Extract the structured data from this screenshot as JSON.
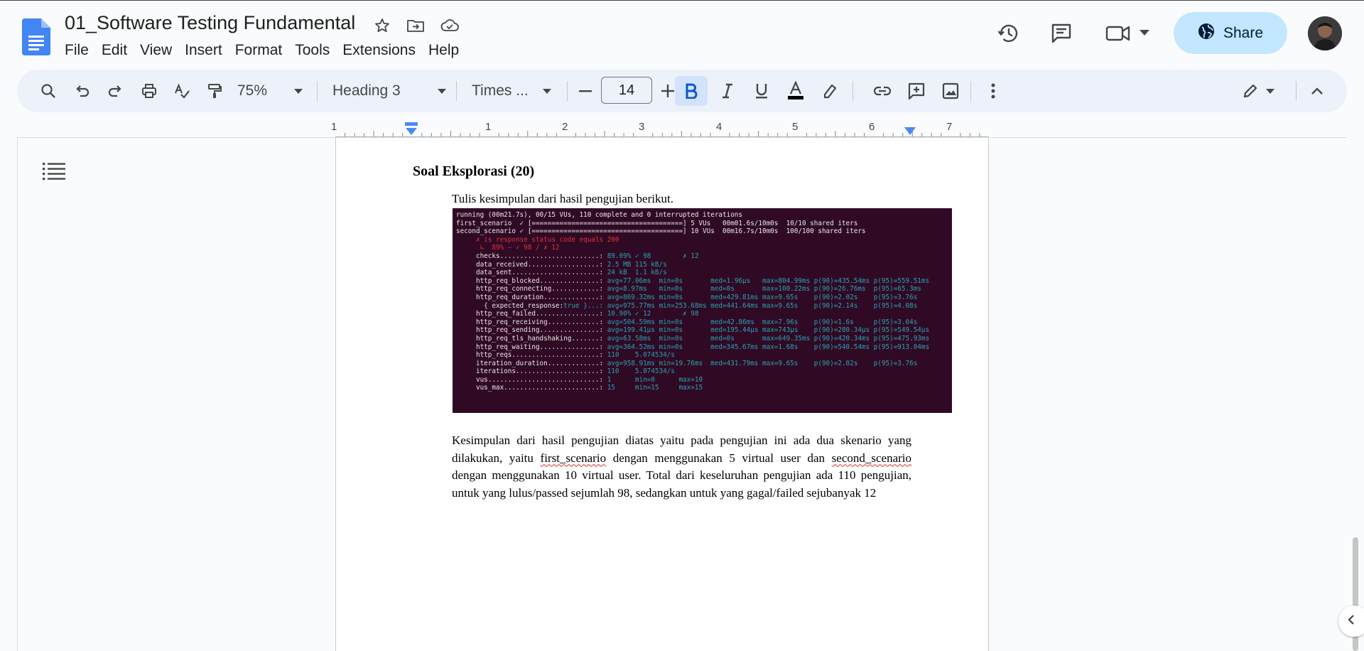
{
  "document": {
    "title": "01_Software Testing Fundamental"
  },
  "menu": [
    "File",
    "Edit",
    "View",
    "Insert",
    "Format",
    "Tools",
    "Extensions",
    "Help"
  ],
  "header": {
    "share_label": "Share"
  },
  "toolbar": {
    "zoom": "75%",
    "style": "Heading 3",
    "font": "Times ...",
    "font_size": "14"
  },
  "ruler": {
    "numbers": [
      "1",
      "1",
      "2",
      "3",
      "4",
      "5",
      "6",
      "7"
    ]
  },
  "page": {
    "heading": "Soal Eksplorasi (20)",
    "instruction": "Tulis kesimpulan dari hasil pengujian berikut.",
    "terminal_lines": [
      "running (00m21.7s), 00/15 VUs, 110 complete and 0 interrupted iterations",
      "first_scenario  ✓ [======================================] 5 VUs   00m01.6s/10m0s  10/10 shared iters",
      "second_scenario ✓ [======================================] 10 VUs  00m16.7s/10m0s  100/100 shared iters",
      "",
      "     ✗ is response status code equals 200",
      "      ↳  89% — ✓ 98 / ✗ 12",
      "",
      "     checks.........................: 89.09% ✓ 98        ✗ 12",
      "     data_received..................: 2.5 MB 115 kB/s",
      "     data_sent......................: 24 kB  1.1 kB/s",
      "     http_req_blocked...............: avg=77.06ms  min=0s       med=1.96µs   max=804.99ms p(90)=435.54ms p(95)=559.51ms",
      "     http_req_connecting............: avg=8.97ms   min=0s       med=0s       max=100.22ms p(90)=26.76ms  p(95)=65.3ms",
      "     http_req_duration..............: avg=869.32ms min=0s       med=429.81ms max=9.65s    p(90)=2.02s    p(95)=3.76s",
      "       { expected_response:true }...: avg=975.77ms min=253.68ms med=441.64ms max=9.65s    p(90)=2.14s    p(95)=4.08s",
      "     http_req_failed................: 10.90% ✓ 12        ✗ 98",
      "     http_req_receiving.............: avg=504.59ms min=0s       med=42.86ms  max=7.96s    p(90)=1.6s     p(95)=3.04s",
      "     http_req_sending...............: avg=199.41µs min=0s       med=195.44µs max=743µs    p(90)=280.34µs p(95)=549.54µs",
      "     http_req_tls_handshaking.......: avg=63.58ms  min=0s       med=0s       max=649.35ms p(90)=420.34ms p(95)=475.93ms",
      "     http_req_waiting...............: avg=364.52ms min=0s       med=345.67ms max=1.68s    p(90)=540.54ms p(95)=913.04ms",
      "     http_reqs......................: 110    5.074534/s",
      "     iteration_duration.............: avg=958.91ms min=19.76ms  med=431.79ms max=9.65s    p(90)=2.02s    p(95)=3.76s",
      "     iterations.....................: 110    5.074534/s",
      "     vus............................: 1      min=0      max=10",
      "     vus_max........................: 15     min=15     max=15"
    ],
    "conclusion": {
      "part1": "Kesimpulan dari hasil pengujian diatas yaitu pada pengujian ini ada dua skenario yang dilakukan, yaitu ",
      "term1": "first_scenario",
      "part2": " dengan menggunakan 5 virtual user  dan ",
      "term2": "second_scenario",
      "part3": " dengan menggunakan 10 virtual user. Total dari keseluruhan pengujian ada 110 pengujian, untuk yang lulus/passed sejumlah 98, sedangkan untuk yang gagal/failed sejubanyak 12"
    }
  },
  "colors": {
    "accent": "#1a73e8",
    "share_bg": "#c2e7ff",
    "terminal_bg": "#300a24"
  }
}
